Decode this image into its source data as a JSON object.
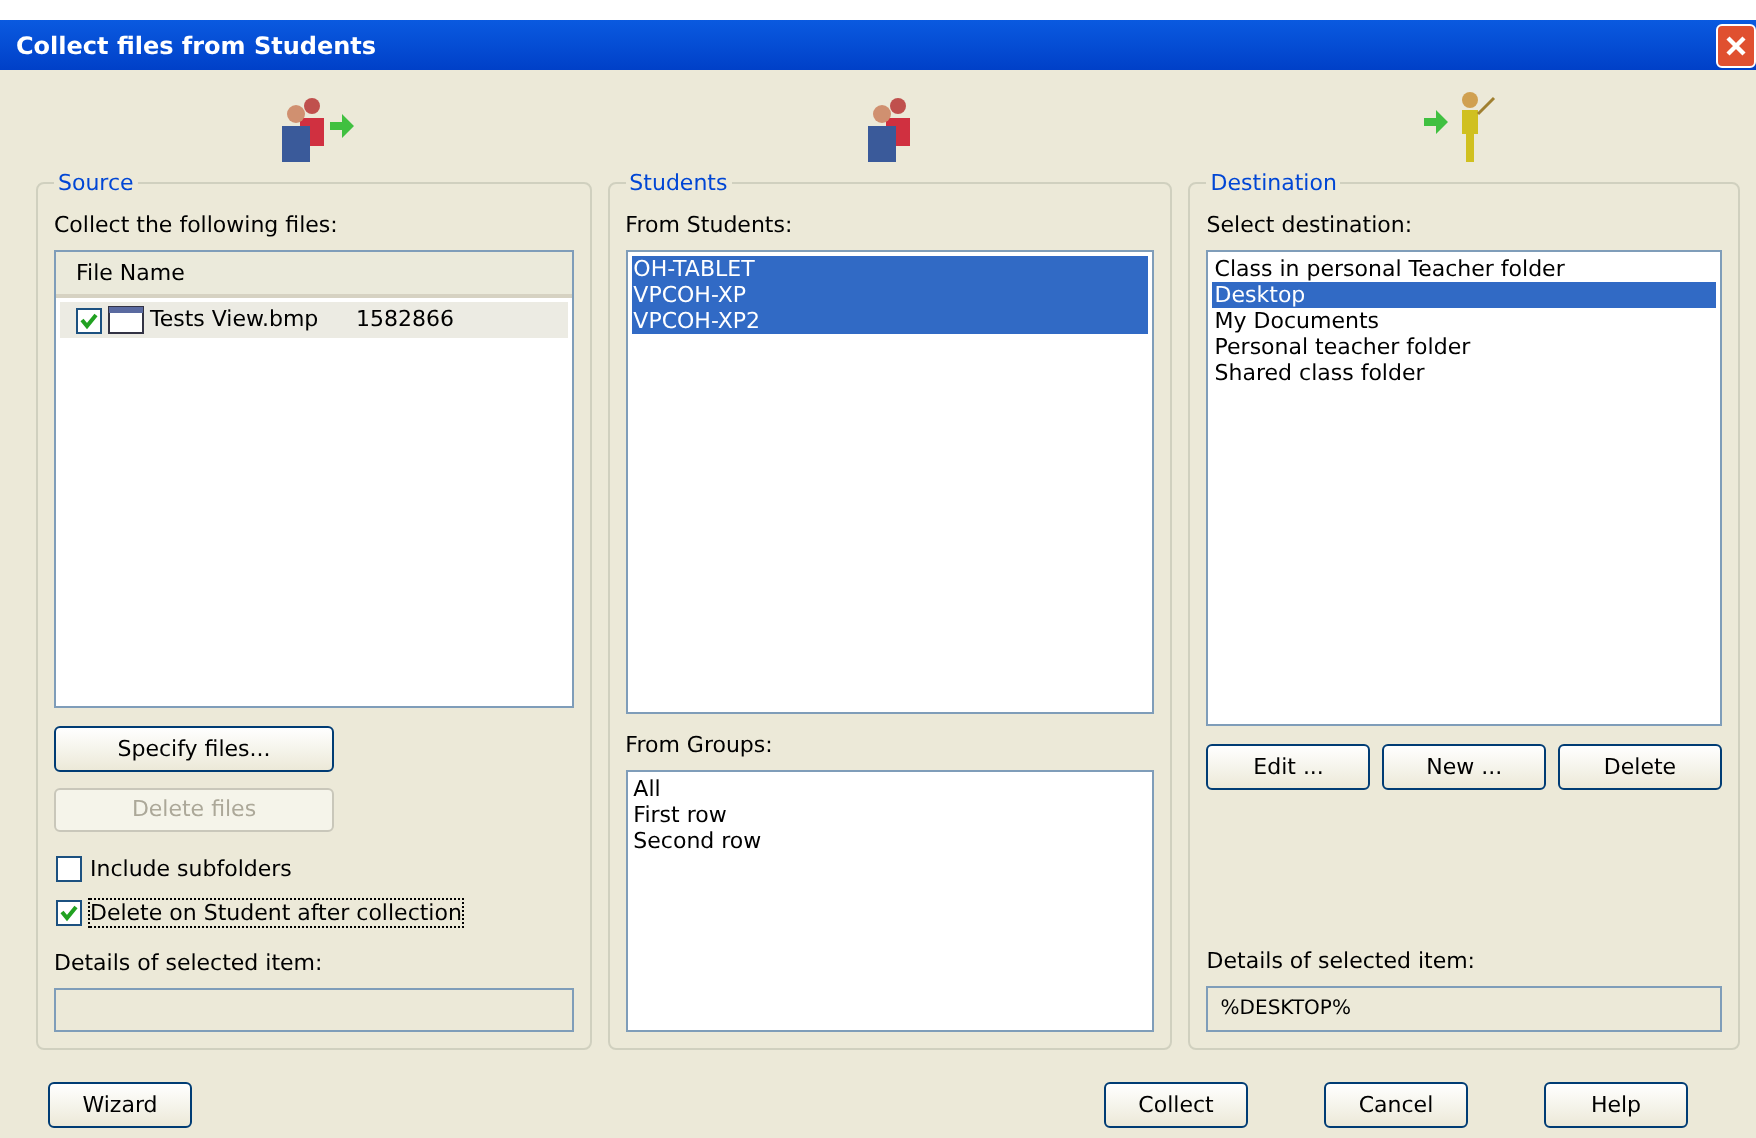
{
  "window": {
    "title": "Collect files from Students"
  },
  "source": {
    "title": "Source",
    "label": "Collect the following files:",
    "columns": [
      "File Name"
    ],
    "files": [
      {
        "name": "Tests View.bmp",
        "size": "1582866",
        "checked": true,
        "selected": true
      }
    ],
    "buttons": [
      {
        "label": "Specify files...",
        "disabled": false
      },
      {
        "label": "Delete files",
        "disabled": true
      }
    ],
    "options": [
      {
        "label": "Include subfolders",
        "checked": false,
        "focused": false
      },
      {
        "label": "Delete on Student after collection",
        "checked": true,
        "focused": true
      }
    ],
    "details_label": "Details of selected item:"
  },
  "students": {
    "title": "Students",
    "from_students_label": "From Students:",
    "students": [
      {
        "name": "OH-TABLET",
        "selected": true
      },
      {
        "name": "VPCOH-XP",
        "selected": true
      },
      {
        "name": "VPCOH-XP2",
        "selected": true
      }
    ],
    "from_groups_label": "From Groups:",
    "groups": [
      {
        "name": "All",
        "selected": false
      },
      {
        "name": "First row",
        "selected": false
      },
      {
        "name": "Second row",
        "selected": false
      }
    ]
  },
  "destination": {
    "title": "Destination",
    "label": "Select destination:",
    "items": [
      {
        "name": "Class in personal Teacher folder",
        "selected": false
      },
      {
        "name": "Desktop",
        "selected": true
      },
      {
        "name": "My Documents",
        "selected": false
      },
      {
        "name": "Personal teacher folder",
        "selected": false
      },
      {
        "name": "Shared class folder",
        "selected": false
      }
    ],
    "buttons": [
      {
        "label": "Edit ...",
        "disabled": false
      },
      {
        "label": "New ...",
        "disabled": false
      },
      {
        "label": "Delete",
        "disabled": false
      }
    ],
    "details_label": "Details of selected item:",
    "details_value": "%DESKTOP%"
  },
  "footer": {
    "left": [
      "Wizard"
    ],
    "right": [
      "Collect",
      "Cancel",
      "Help"
    ]
  }
}
